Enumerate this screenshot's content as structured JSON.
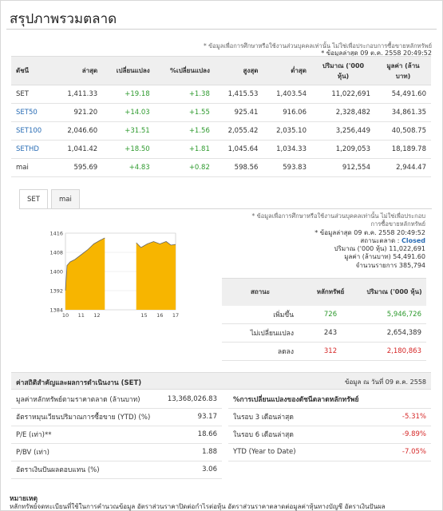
{
  "page_title": "สรุปภาพรวมตลาด",
  "top_note": "* ข้อมูลเพื่อการศึกษาหรือใช้งานส่วนบุคคลเท่านั้น ไม่ใช่เพื่อประกอบการซื้อขายหลักทรัพย์",
  "top_asof": "* ข้อมูลล่าสุด 09 ต.ค. 2558 20:49:52",
  "index_table": {
    "headers": [
      "ดัชนี",
      "ล่าสุด",
      "เปลี่ยนแปลง",
      "%เปลี่ยนแปลง",
      "สูงสุด",
      "ต่ำสุด",
      "ปริมาณ ('000 หุ้น)",
      "มูลค่า (ล้านบาท)"
    ],
    "rows": [
      {
        "name": "SET",
        "last": "1,411.33",
        "change": "+19.18",
        "pct": "+1.38",
        "high": "1,415.53",
        "low": "1,403.54",
        "volume": "11,022,691",
        "value": "54,491.60",
        "link": false
      },
      {
        "name": "SET50",
        "last": "921.20",
        "change": "+14.03",
        "pct": "+1.55",
        "high": "925.41",
        "low": "916.06",
        "volume": "2,328,482",
        "value": "34,861.35",
        "link": true
      },
      {
        "name": "SET100",
        "last": "2,046.60",
        "change": "+31.51",
        "pct": "+1.56",
        "high": "2,055.42",
        "low": "2,035.10",
        "volume": "3,256,449",
        "value": "40,508.75",
        "link": true
      },
      {
        "name": "SETHD",
        "last": "1,041.42",
        "change": "+18.50",
        "pct": "+1.81",
        "high": "1,045.64",
        "low": "1,034.33",
        "volume": "1,209,053",
        "value": "18,189.78",
        "link": true
      },
      {
        "name": "mai",
        "last": "595.69",
        "change": "+4.83",
        "pct": "+0.82",
        "high": "598.56",
        "low": "593.83",
        "volume": "912,554",
        "value": "2,944.47",
        "link": false
      }
    ]
  },
  "tabs": [
    {
      "label": "SET",
      "active": true
    },
    {
      "label": "mai",
      "active": false
    }
  ],
  "info": {
    "note_line1": "* ข้อมูลเพื่อการศึกษาหรือใช้งานส่วนบุคคลเท่านั้น ไม่ใช่เพื่อประกอบ",
    "note_line2": "การซื้อขายหลักทรัพย์",
    "asof": "* ข้อมูลล่าสุด 09 ต.ค. 2558 20:49:52",
    "status_label": "สถานะตลาด :",
    "status_value": "Closed",
    "volume_line": "ปริมาณ ('000 หุ้น)  11,022,691",
    "value_line": "มูลค่า (ล้านบาท)  54,491.60",
    "deals_line": "จำนวนรายการ  385,794"
  },
  "breadth": {
    "headers": [
      "สถานะ",
      "หลักทรัพย์",
      "ปริมาณ ('000 หุ้น)"
    ],
    "rows": [
      {
        "label": "เพิ่มขึ้น",
        "count": "726",
        "volume": "5,946,726",
        "color": "#2e9a2e"
      },
      {
        "label": "ไม่เปลี่ยนแปลง",
        "count": "243",
        "volume": "2,654,389",
        "color": "#333333"
      },
      {
        "label": "ลดลง",
        "count": "312",
        "volume": "2,180,863",
        "color": "#d62828"
      }
    ]
  },
  "stats_header": {
    "left": "ค่าสถิติสำคัญและผลการดำเนินงาน (SET)",
    "right": "ข้อมูล ณ วันที่ 09 ต.ค. 2558"
  },
  "stats_left": [
    {
      "label": "มูลค่าหลักทรัพย์ตามราคาตลาด (ล้านบาท)",
      "value": "13,368,026.83"
    },
    {
      "label": "อัตราหมุนเวียนปริมาณการซื้อขาย (YTD) (%)",
      "value": "93.17"
    },
    {
      "label": "P/E (เท่า)**",
      "value": "18.66"
    },
    {
      "label": "P/BV (เท่า)",
      "value": "1.88"
    },
    {
      "label": "อัตราเงินปันผลตอบแทน (%)",
      "value": "3.06"
    }
  ],
  "stats_right_title": "%การเปลี่ยนแปลงของดัชนีตลาดหลักทรัพย์",
  "stats_right": [
    {
      "label": "ในรอบ 3 เดือนล่าสุด",
      "value": "-5.31%"
    },
    {
      "label": "ในรอบ 6 เดือนล่าสุด",
      "value": "-9.89%"
    },
    {
      "label": "YTD (Year to Date)",
      "value": "-7.05%"
    }
  ],
  "remark_title": "หมายเหตุ",
  "remark_text": "หลักทรัพย์จดทะเบียนที่ใช้ในการคำนวณข้อมูล อัตราส่วนราคาปิดต่อกำไรต่อหุ้น อัตราส่วนราคาตลาดต่อมูลค่าหุ้นทางบัญชี อัตราเงินปันผล",
  "chart_data": {
    "type": "area",
    "x_ticks": [
      "10",
      "11",
      "12",
      "15",
      "16",
      "17"
    ],
    "y_ticks": [
      "1416",
      "1408",
      "1400",
      "1392",
      "1384"
    ],
    "ylim": [
      1384,
      1416
    ],
    "fill_color": "#f7b500",
    "line_color": "#666666",
    "sessions": [
      {
        "x": [
          10.0,
          10.1,
          10.3,
          10.6,
          11.0,
          11.4,
          11.8,
          12.2,
          12.5
        ],
        "y": [
          1392,
          1402.5,
          1404,
          1405,
          1407,
          1409,
          1411.5,
          1413,
          1414
        ]
      },
      {
        "x": [
          14.5,
          14.8,
          15.2,
          15.6,
          16.0,
          16.4,
          16.7,
          17.0
        ],
        "y": [
          1412,
          1410,
          1411.5,
          1412.5,
          1411.5,
          1412.5,
          1411,
          1411.3
        ]
      }
    ]
  }
}
